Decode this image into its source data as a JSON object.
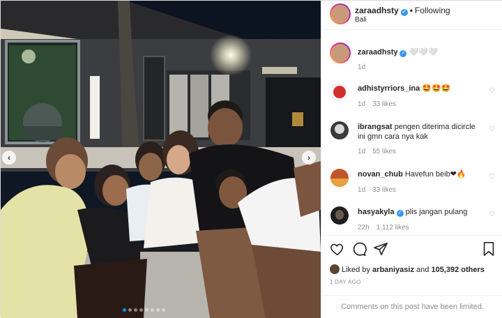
{
  "post": {
    "username": "zaraadhsty",
    "separator": "•",
    "follow_label": "Following",
    "location": "Bali"
  },
  "caption": {
    "username": "zaraadhsty",
    "text": "🤍🤍🤍",
    "time": "1d"
  },
  "comments": [
    {
      "username": "adhistyrriors_ina",
      "text": "🤩🤩🤩",
      "time": "1d",
      "likes": "33 likes",
      "avatar_color": "#d0302c"
    },
    {
      "username": "ibrangsat",
      "text": "pengen diterima dicircle ini gmn cara nya kak",
      "time": "1d",
      "likes": "55 likes",
      "avatar_color": "#3a3a3a"
    },
    {
      "username": "novan_chub",
      "text": "Havefun beib❤🔥",
      "time": "1d",
      "likes": "33 likes",
      "avatar_color": "#c0552a"
    },
    {
      "username": "hasyakyla",
      "text": "plis jangan pulang",
      "time": "22h",
      "likes": "1.112 likes",
      "avatar_color": "#1e1e1e"
    }
  ],
  "icons": {
    "verified": "✓",
    "heart_small": "♡",
    "nav_left": "‹",
    "nav_right": "›"
  },
  "likes_summary": {
    "prefix": "Liked by",
    "user": "arbaniyasiz",
    "conjunction": "and",
    "others": "105,392 others"
  },
  "posted_date": "1 DAY AGO",
  "comments_limited": "Comments on this post have been limited.",
  "carousel": {
    "slides": 8,
    "active_index": 0
  },
  "colors": {
    "accent": "#0095f6",
    "verified": "#3897f0",
    "muted": "#8e8e8e"
  }
}
